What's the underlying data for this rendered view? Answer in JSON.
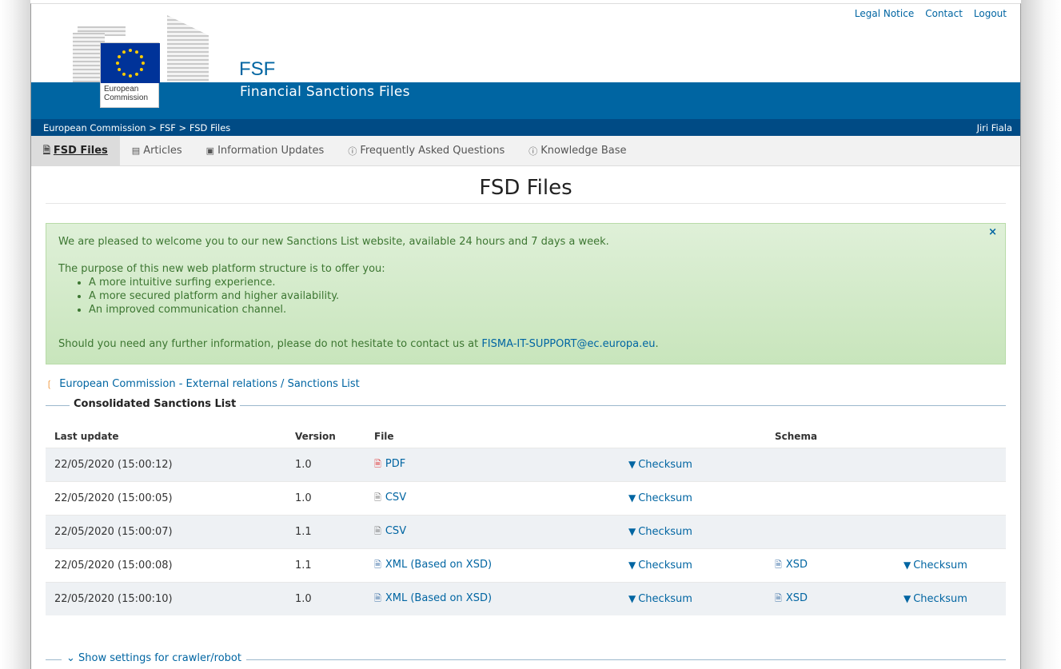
{
  "header": {
    "site_code": "FSF",
    "site_name": "Financial Sanctions Files",
    "logo_text_line1": "European",
    "logo_text_line2": "Commission",
    "top_links": [
      "Legal Notice",
      "Contact",
      "Logout"
    ]
  },
  "breadcrumb": {
    "items": [
      "European Commission",
      "FSF",
      "FSD Files"
    ],
    "separator": ">",
    "user": "Jiri Fiala"
  },
  "nav": {
    "tabs": [
      {
        "label": "FSD Files",
        "icon": "document-icon",
        "active": true
      },
      {
        "label": "Articles",
        "icon": "newspaper-icon",
        "active": false
      },
      {
        "label": "Information Updates",
        "icon": "note-icon",
        "active": false
      },
      {
        "label": "Frequently Asked Questions",
        "icon": "question-circle-icon",
        "active": false
      },
      {
        "label": "Knowledge Base",
        "icon": "info-circle-icon",
        "active": false
      }
    ]
  },
  "main": {
    "title": "FSD Files",
    "alert": {
      "line1": "We are pleased to welcome you to our new Sanctions List website, available 24 hours and 7 days a week.",
      "line2": "The purpose of this new web platform structure is to offer you:",
      "bullets": [
        "A more intuitive surfing experience.",
        "A more secured platform and higher availability.",
        "An improved communication channel."
      ],
      "contact_prefix": "Should you need any further information, please do not hesitate to contact us at ",
      "contact_email": "FISMA-IT-SUPPORT@ec.europa.eu",
      "contact_suffix": ".",
      "close": "×"
    },
    "rss_link": "European Commission - External relations / Sanctions List",
    "section_title": "Consolidated Sanctions List",
    "table": {
      "headers": [
        "Last update",
        "Version",
        "File",
        "",
        "Schema",
        ""
      ],
      "rows": [
        {
          "date": "22/05/2020 (15:00:12)",
          "version": "1.0",
          "file": "PDF",
          "file_icon": "pdf-icon",
          "checksum": "Checksum",
          "schema": "",
          "schema_checksum": ""
        },
        {
          "date": "22/05/2020 (15:00:05)",
          "version": "1.0",
          "file": "CSV",
          "file_icon": "text-file-icon",
          "checksum": "Checksum",
          "schema": "",
          "schema_checksum": ""
        },
        {
          "date": "22/05/2020 (15:00:07)",
          "version": "1.1",
          "file": "CSV",
          "file_icon": "text-file-icon",
          "checksum": "Checksum",
          "schema": "",
          "schema_checksum": ""
        },
        {
          "date": "22/05/2020 (15:00:08)",
          "version": "1.1",
          "file": "XML (Based on XSD)",
          "file_icon": "xml-file-icon",
          "checksum": "Checksum",
          "schema": "XSD",
          "schema_checksum": "Checksum"
        },
        {
          "date": "22/05/2020 (15:00:10)",
          "version": "1.0",
          "file": "XML (Based on XSD)",
          "file_icon": "xml-file-icon",
          "checksum": "Checksum",
          "schema": "XSD",
          "schema_checksum": "Checksum"
        }
      ]
    },
    "crawler_toggle": "Show settings for crawler/robot"
  },
  "colors": {
    "brand_blue": "#0065a2",
    "dark_blue": "#004b85",
    "alert_green": "#dff0d8",
    "alert_text": "#3c7631"
  }
}
